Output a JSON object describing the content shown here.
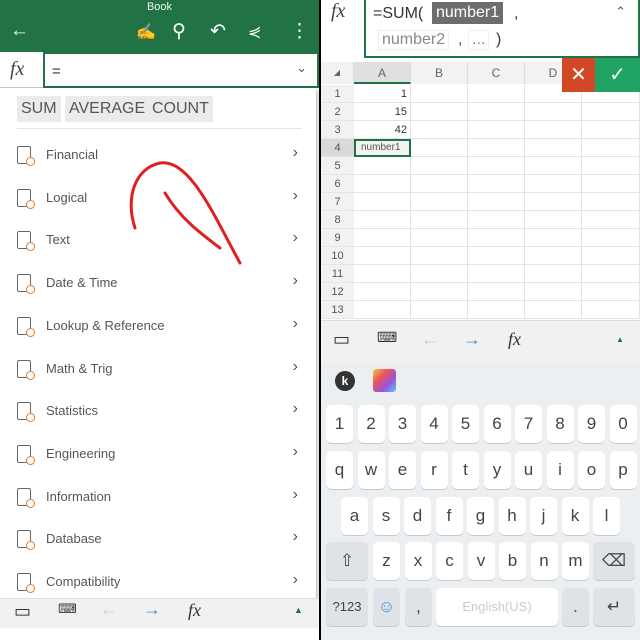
{
  "left": {
    "header": {
      "title": "Book",
      "icons": [
        "back-arrow-icon",
        "draw-pen-icon",
        "search-icon",
        "undo-icon",
        "share-icon",
        "more-vertical-icon"
      ]
    },
    "formula_bar": {
      "fx": "fx",
      "value": "="
    },
    "shortcuts": [
      "SUM",
      "AVERAGE",
      "COUNT"
    ],
    "categories": [
      {
        "label": "Financial",
        "icon": "financial-icon"
      },
      {
        "label": "Logical",
        "icon": "logical-icon"
      },
      {
        "label": "Text",
        "icon": "text-icon"
      },
      {
        "label": "Date & Time",
        "icon": "date-time-icon"
      },
      {
        "label": "Lookup & Reference",
        "icon": "lookup-icon"
      },
      {
        "label": "Math & Trig",
        "icon": "math-trig-icon"
      },
      {
        "label": "Statistics",
        "icon": "statistics-icon"
      },
      {
        "label": "Engineering",
        "icon": "engineering-icon"
      },
      {
        "label": "Information",
        "icon": "information-icon"
      },
      {
        "label": "Database",
        "icon": "database-icon"
      },
      {
        "label": "Compatibility",
        "icon": "compatibility-icon"
      }
    ],
    "toolbar": {
      "fx": "fx"
    }
  },
  "right": {
    "formula_bar": {
      "fx": "fx",
      "prefix": "=SUM(",
      "arg1": "number1",
      "comma": ",",
      "arg2": "number2",
      "ellipsis": "...",
      "close": ")"
    },
    "columns": [
      "A",
      "B",
      "C",
      "D"
    ],
    "rows": [
      "1",
      "2",
      "3",
      "4",
      "5",
      "6",
      "7",
      "8",
      "9",
      "10",
      "11",
      "12",
      "13"
    ],
    "cells": {
      "A1": "1",
      "A2": "15",
      "A3": "42",
      "A4": "number1"
    },
    "toolbar": {
      "fx": "fx"
    },
    "keyboard": {
      "numbers": [
        "1",
        "2",
        "3",
        "4",
        "5",
        "6",
        "7",
        "8",
        "9",
        "0"
      ],
      "row1": [
        "q",
        "w",
        "e",
        "r",
        "t",
        "y",
        "u",
        "i",
        "o",
        "p"
      ],
      "row2": [
        "a",
        "s",
        "d",
        "f",
        "g",
        "h",
        "j",
        "k",
        "l"
      ],
      "row3": [
        "z",
        "x",
        "c",
        "v",
        "b",
        "n",
        "m"
      ],
      "symbols_key": "?123",
      "comma": ",",
      "space": "English(US)",
      "period": "."
    }
  },
  "colors": {
    "accent": "#217346",
    "cancel": "#d24726",
    "annotation": "#e02020"
  }
}
